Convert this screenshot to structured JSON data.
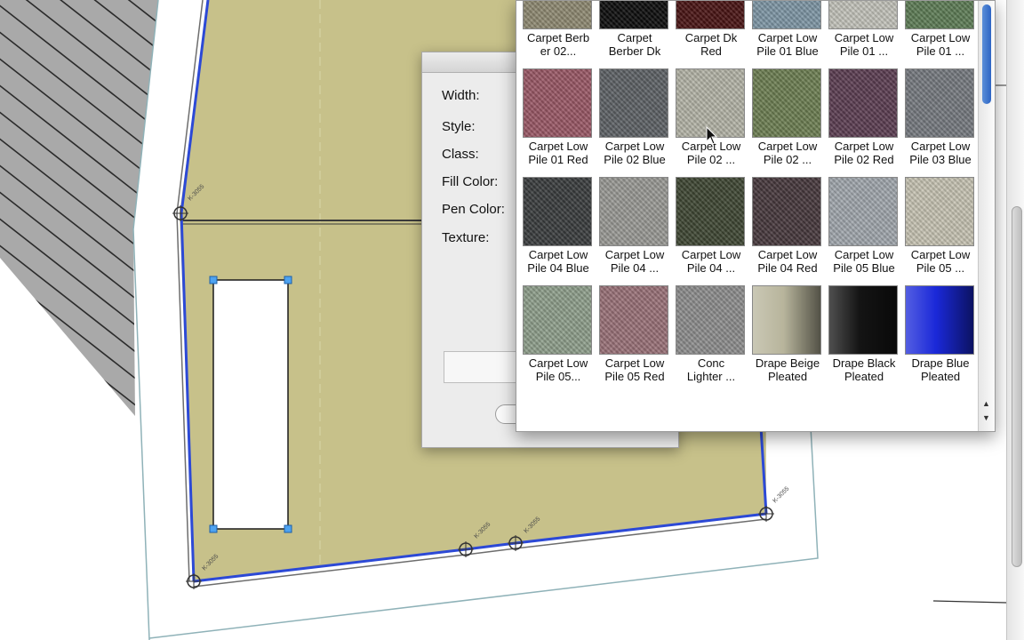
{
  "dialog": {
    "labels": {
      "width": "Width:",
      "style": "Style:",
      "class": "Class:",
      "fill_color": "Fill Color:",
      "pen_color": "Pen Color:",
      "texture": "Texture:"
    }
  },
  "plan": {
    "wall_tag": "K-3055"
  },
  "texture_picker": {
    "rows": [
      [
        {
          "line1": "Carpet Berb",
          "line2": "er 02...",
          "color": "#8f8a72"
        },
        {
          "line1": "Carpet",
          "line2": "Berber Dk",
          "color": "#0d0d0d"
        },
        {
          "line1": "Carpet Dk",
          "line2": "Red",
          "color": "#4a1414"
        },
        {
          "line1": "Carpet Low",
          "line2": "Pile 01 Blue",
          "color": "#7f97a6"
        },
        {
          "line1": "Carpet Low",
          "line2": "Pile 01 ...",
          "color": "#c4c4bc"
        },
        {
          "line1": "Carpet Low",
          "line2": "Pile 01 ...",
          "color": "#5e7d56"
        }
      ],
      [
        {
          "line1": "Carpet Low",
          "line2": "Pile 01 Red",
          "color": "#9a5866"
        },
        {
          "line1": "Carpet Low",
          "line2": "Pile 02 Blue",
          "color": "#5e6266"
        },
        {
          "line1": "Carpet Low",
          "line2": "Pile 02 ...",
          "color": "#b5b5a8"
        },
        {
          "line1": "Carpet Low",
          "line2": "Pile 02 ...",
          "color": "#6d7f52"
        },
        {
          "line1": "Carpet Low",
          "line2": "Pile 02 Red",
          "color": "#5c3e52"
        },
        {
          "line1": "Carpet Low",
          "line2": "Pile 03 Blue",
          "color": "#767a80"
        }
      ],
      [
        {
          "line1": "Carpet Low",
          "line2": "Pile 04 Blue",
          "color": "#3a3d3e"
        },
        {
          "line1": "Carpet Low",
          "line2": "Pile 04 ...",
          "color": "#9a9a96"
        },
        {
          "line1": "Carpet Low",
          "line2": "Pile 04 ...",
          "color": "#3f4733"
        },
        {
          "line1": "Carpet Low",
          "line2": "Pile 04 Red",
          "color": "#47383d"
        },
        {
          "line1": "Carpet Low",
          "line2": "Pile 05 Blue",
          "color": "#a2a8ae"
        },
        {
          "line1": "Carpet Low",
          "line2": "Pile 05 ...",
          "color": "#c8c4b4"
        }
      ],
      [
        {
          "line1": "Carpet Low",
          "line2": "Pile 05...",
          "color": "#8fa08c"
        },
        {
          "line1": "Carpet Low",
          "line2": "Pile 05 Red",
          "color": "#9a7278"
        },
        {
          "line1": "Conc",
          "line2": "Lighter ...",
          "color": "#8e8e8e"
        },
        {
          "line1": "Drape Beige",
          "line2": "Pleated",
          "color": "#b8b59c"
        },
        {
          "line1": "Drape Black",
          "line2": "Pleated",
          "color": "#141414"
        },
        {
          "line1": "Drape Blue",
          "line2": "Pleated",
          "color": "#1a28d8"
        }
      ]
    ]
  },
  "colors": {
    "room_fill": "#c7c18a",
    "wall_blue": "#2c49d6",
    "selection_handle": "#4ea3f0"
  }
}
